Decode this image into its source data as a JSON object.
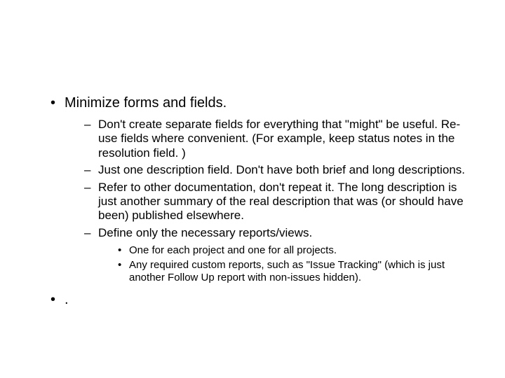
{
  "bullets": [
    {
      "text": "Minimize forms and fields.",
      "children": [
        {
          "text": "Don't create separate fields for everything that \"might\" be useful. Re-use fields where convenient. (For example, keep status notes in the resolution field. )"
        },
        {
          "text": "Just one description field. Don't have both brief and long descriptions."
        },
        {
          "text": "Refer to other documentation, don't repeat it. The long description is just another summary of the real description that was (or should have been) published elsewhere."
        },
        {
          "text": "Define only the necessary reports/views.",
          "children": [
            {
              "text": "One for each project and one for all projects."
            },
            {
              "text": "Any required custom reports, such as \"Issue Tracking\" (which is just another Follow Up report with non-issues hidden)."
            }
          ]
        }
      ]
    },
    {
      "text": "."
    }
  ]
}
